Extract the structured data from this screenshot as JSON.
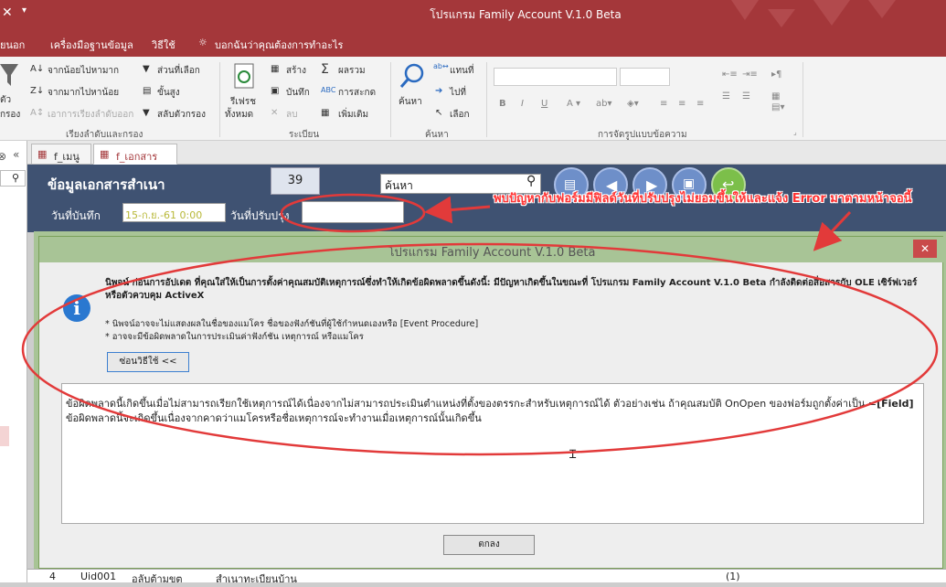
{
  "titlebar": {
    "title": "โปรแกรม Family Account  V.1.0 Beta"
  },
  "menu": {
    "items": [
      "ยนอก",
      "เครื่องมือฐานข้อมูล",
      "วิธีใช้",
      "บอกฉันว่าคุณต้องการทำอะไร"
    ]
  },
  "ribbon": {
    "sort_filter": {
      "asc": "จากน้อยไปหามาก",
      "desc": "จากมากไปหาน้อย",
      "remove": "เอาการเรียงลำดับออก",
      "selection": "ส่วนที่เลือก",
      "advanced": "ขั้นสูง",
      "toggle": "สลับตัวกรอง",
      "filter_label": "ตัว",
      "filter_label2": "กรอง",
      "group": "เรียงลำดับและกรอง"
    },
    "records": {
      "refresh": "รีเฟรช",
      "refresh2": "ทั้งหมด",
      "new": "สร้าง",
      "save": "บันทึก",
      "delete": "ลบ",
      "totals": "ผลรวม",
      "spelling": "การสะกด",
      "more": "เพิ่มเติม",
      "group": "ระเบียน"
    },
    "find": {
      "find": "ค้นหา",
      "replace": "แทนที่",
      "goto": "ไปที่",
      "select": "เลือก",
      "group": "ค้นหา"
    },
    "formatting": {
      "group": "การจัดรูปแบบข้อความ"
    }
  },
  "tabs": [
    {
      "label": "f_เมนู"
    },
    {
      "label": "f_เอกสาร"
    }
  ],
  "form": {
    "title": "ข้อมูลเอกสารสำเนา",
    "record_number": "39",
    "search_placeholder": "ค้นหา",
    "saved_date_label": "วันที่บันทึก",
    "saved_date_value": "15-ก.ย.-61 0:00",
    "updated_date_label": "วันที่ปรับปรุง"
  },
  "annotation": {
    "text": "พบปัญหากับฟอร์มมีฟิลด์วันที่ปรับปรุงไม่ยอมขึ้นให้และแจ้ง Error มาตามหน้าจอนี้"
  },
  "dialog": {
    "title": "โปรแกรม Family Account  V.1.0 Beta",
    "close": "✕",
    "message": "นิพจน์ ก่อนการอัปเดต ที่คุณใส่ให้เป็นการตั้งค่าคุณสมบัติเหตุการณ์ซึ่งทำให้เกิดข้อผิดพลาดขึ้นดังนี้: มีปัญหาเกิดขึ้นในขณะที่ โปรแกรม Family Account  V.1.0 Beta กำลังติดต่อสื่อสารกับ OLE เซิร์ฟเวอร์หรือตัวควบคุม ActiveX",
    "note1": "* นิพจน์อาจจะไม่แสดงผลในชื่อของแมโคร ชื่อของฟังก์ชันที่ผู้ใช้กำหนดเองหรือ [Event Procedure]",
    "note2": "* อาจจะมีข้อผิดพลาดในการประเมินค่าฟังก์ชัน เหตุการณ์ หรือแมโคร",
    "hide_button": "ซ่อนวิธีใช้ <<",
    "detail1": "ข้อผิดพลาดนี้เกิดขึ้นเมื่อไม่สามารถเรียกใช้เหตุการณ์ได้เนื่องจากไม่สามารถประเมินตำแหน่งที่ตั้งของตรรกะสำหรับเหตุการณ์ได้ ตัวอย่างเช่น ถ้าคุณสมบัติ OnOpen ของฟอร์มถูกตั้งค่าเป็น =",
    "detail1b": "[Field]",
    "detail2": "ข้อผิดพลาดนี้จะเกิดขึ้นเนื่องจากคาดว่าแมโครหรือชื่อเหตุการณ์จะทำงานเมื่อเหตุการณ์นั้นเกิดขึ้น",
    "ok_button": "ตกลง"
  },
  "datarow": {
    "num": "4",
    "id": "Uid001",
    "c3": "อลับต้ามขต",
    "c4": "สำเนาทะเบียนบ้าน",
    "c5": "(1)"
  }
}
